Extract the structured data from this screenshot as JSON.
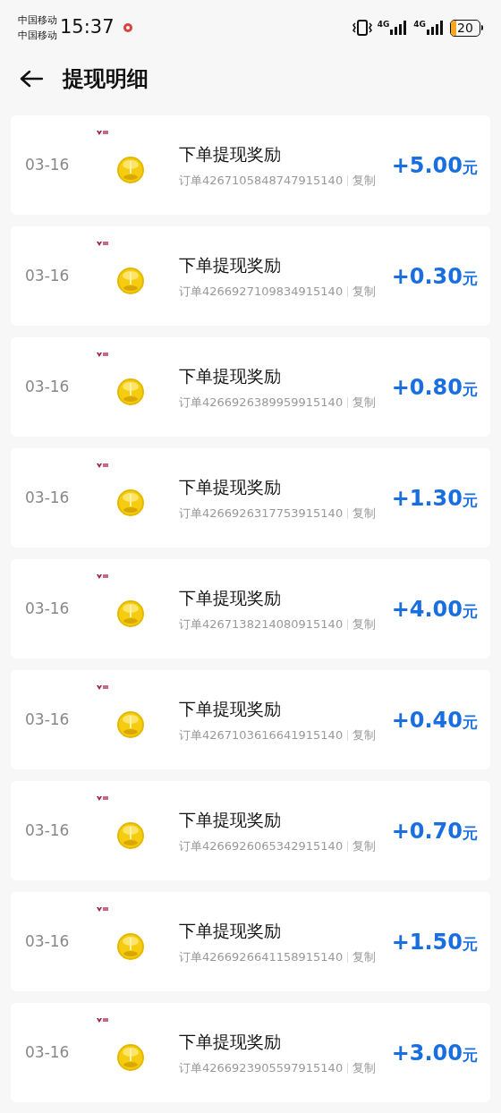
{
  "status_bar": {
    "carriers": [
      "中国移动",
      "中国移动"
    ],
    "time": "15:37",
    "signals": [
      {
        "label": "4G"
      },
      {
        "label": "4G"
      }
    ],
    "battery": "20"
  },
  "header": {
    "title": "提现明细"
  },
  "records": [
    {
      "date": "03-16",
      "title": "下单提现奖励",
      "order": "订单4267105848747915140",
      "copy": "复制",
      "amount": "+5.00",
      "unit": "元"
    },
    {
      "date": "03-16",
      "title": "下单提现奖励",
      "order": "订单4266927109834915140",
      "copy": "复制",
      "amount": "+0.30",
      "unit": "元"
    },
    {
      "date": "03-16",
      "title": "下单提现奖励",
      "order": "订单4266926389959915140",
      "copy": "复制",
      "amount": "+0.80",
      "unit": "元"
    },
    {
      "date": "03-16",
      "title": "下单提现奖励",
      "order": "订单4266926317753915140",
      "copy": "复制",
      "amount": "+1.30",
      "unit": "元"
    },
    {
      "date": "03-16",
      "title": "下单提现奖励",
      "order": "订单4267138214080915140",
      "copy": "复制",
      "amount": "+4.00",
      "unit": "元"
    },
    {
      "date": "03-16",
      "title": "下单提现奖励",
      "order": "订单4267103616641915140",
      "copy": "复制",
      "amount": "+0.40",
      "unit": "元"
    },
    {
      "date": "03-16",
      "title": "下单提现奖励",
      "order": "订单4266926065342915140",
      "copy": "复制",
      "amount": "+0.70",
      "unit": "元"
    },
    {
      "date": "03-16",
      "title": "下单提现奖励",
      "order": "订单4266926641158915140",
      "copy": "复制",
      "amount": "+1.50",
      "unit": "元"
    },
    {
      "date": "03-16",
      "title": "下单提现奖励",
      "order": "订单4266923905597915140",
      "copy": "复制",
      "amount": "+3.00",
      "unit": "元"
    }
  ]
}
